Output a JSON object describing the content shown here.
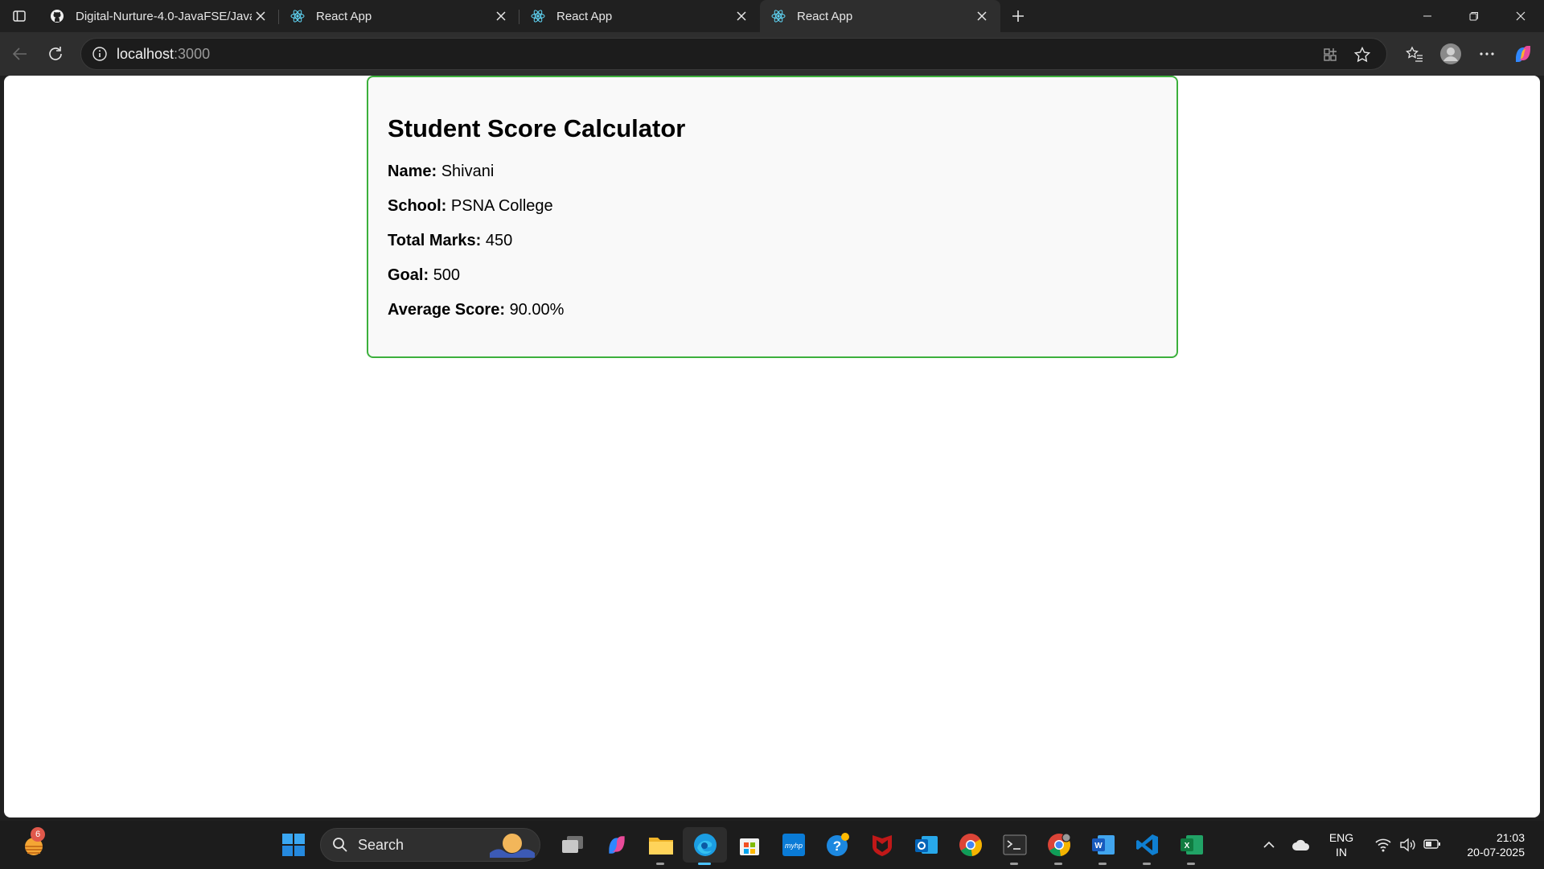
{
  "browser": {
    "tabs": [
      {
        "title": "Digital-Nurture-4.0-JavaFSE/Java",
        "favicon": "github-icon",
        "active": false
      },
      {
        "title": "React App",
        "favicon": "react-icon",
        "active": false
      },
      {
        "title": "React App",
        "favicon": "react-icon",
        "active": false
      },
      {
        "title": "React App",
        "favicon": "react-icon",
        "active": true
      }
    ],
    "url_host": "localhost",
    "url_port": ":3000"
  },
  "page": {
    "heading": "Student Score Calculator",
    "fields": [
      {
        "label": "Name:",
        "value": "Shivani"
      },
      {
        "label": "School:",
        "value": "PSNA College"
      },
      {
        "label": "Total Marks:",
        "value": "450"
      },
      {
        "label": "Goal:",
        "value": "500"
      },
      {
        "label": "Average Score:",
        "value": "90.00%"
      }
    ],
    "card_border_color": "#3cb03c"
  },
  "taskbar": {
    "widget_badge": "6",
    "search_label": "Search",
    "language": "ENG",
    "region": "IN",
    "time": "21:03",
    "date": "20-07-2025"
  }
}
